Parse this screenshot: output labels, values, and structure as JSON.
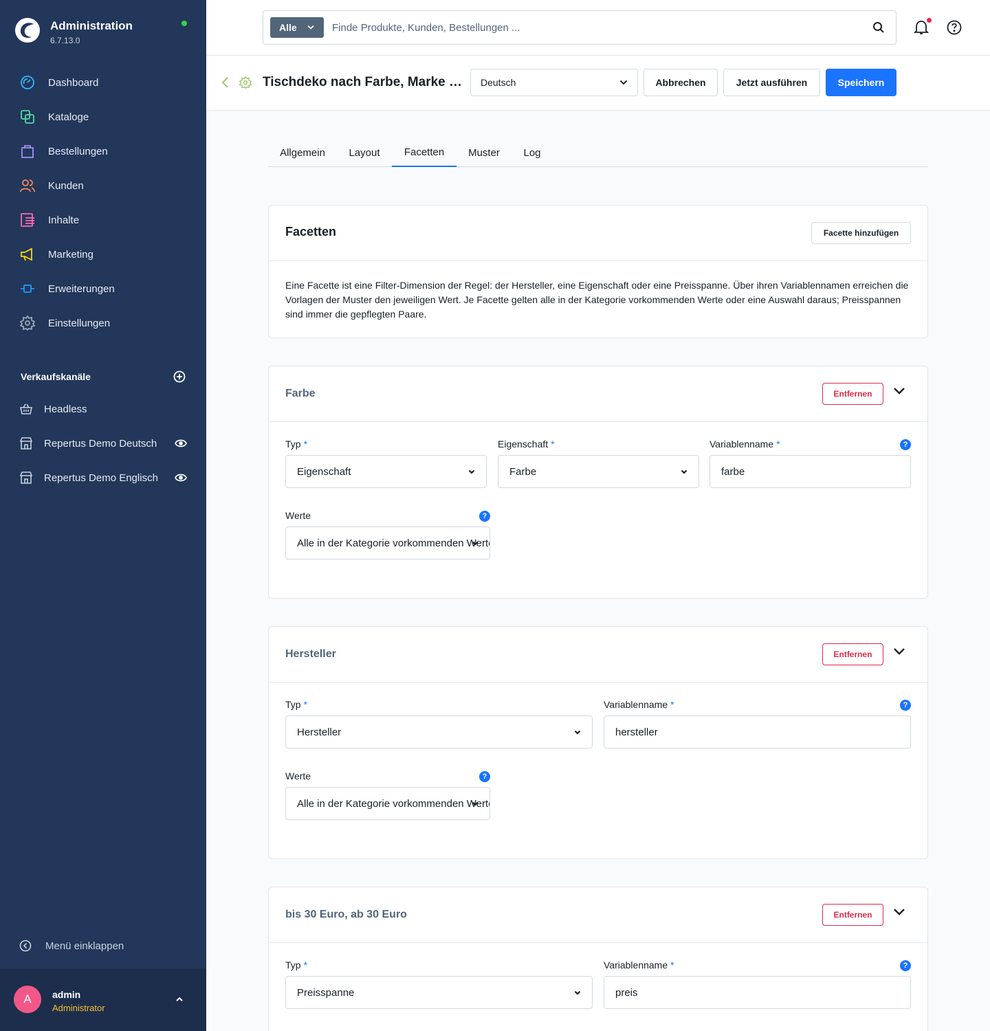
{
  "brand": {
    "title": "Administration",
    "version": "6.7.13.0"
  },
  "nav": [
    {
      "label": "Dashboard",
      "icon": "gauge-icon",
      "color": "#33b8ff"
    },
    {
      "label": "Kataloge",
      "icon": "catalog-icon",
      "color": "#57d9a3"
    },
    {
      "label": "Bestellungen",
      "icon": "shopping-bag-icon",
      "color": "#a092f0"
    },
    {
      "label": "Kunden",
      "icon": "users-icon",
      "color": "#f88962"
    },
    {
      "label": "Inhalte",
      "icon": "content-icon",
      "color": "#ff68b4"
    },
    {
      "label": "Marketing",
      "icon": "megaphone-icon",
      "color": "#ffd700"
    },
    {
      "label": "Erweiterungen",
      "icon": "plug-icon",
      "color": "#189eff"
    },
    {
      "label": "Einstellungen",
      "icon": "gear-icon",
      "color": "#9aa8b5"
    }
  ],
  "sales_channels": {
    "heading": "Verkaufskanäle",
    "items": [
      {
        "label": "Headless",
        "icon": "basket-icon"
      },
      {
        "label": "Repertus Demo Deutsch",
        "icon": "storefront-icon"
      },
      {
        "label": "Repertus Demo Englisch",
        "icon": "storefront-icon"
      }
    ]
  },
  "collapse_label": "Menü einklappen",
  "user": {
    "initial": "A",
    "name": "admin",
    "role": "Administrator"
  },
  "search": {
    "type": "Alle",
    "placeholder": "Finde Produkte, Kunden, Bestellungen ..."
  },
  "smartbar": {
    "title": "Tischdeko nach Farbe, Marke und Preis",
    "language": "Deutsch",
    "cancel": "Abbrechen",
    "run": "Jetzt ausführen",
    "save": "Speichern"
  },
  "tabs": [
    "Allgemein",
    "Layout",
    "Facetten",
    "Muster",
    "Log"
  ],
  "facets_card": {
    "title": "Facetten",
    "add_button": "Facette hinzufügen",
    "description": "Eine Facette ist eine Filter-Dimension der Regel: der Hersteller, eine Eigenschaft oder eine Preisspanne. Über ihren Variablennamen erreichen die Vorlagen der Muster den jeweiligen Wert. Je Facette gelten alle in der Kategorie vorkommenden Werte oder eine Auswahl daraus; Preisspannen sind immer die gepflegten Paare."
  },
  "labels": {
    "type": "Typ",
    "property": "Eigenschaft",
    "variable": "Variablenname",
    "values": "Werte",
    "remove": "Entfernen",
    "required": "*",
    "help": "?"
  },
  "facets": [
    {
      "title": "Farbe",
      "type": "Eigenschaft",
      "property": "Farbe",
      "variable": "farbe",
      "values": "Alle in der Kategorie vorkommenden Werte"
    },
    {
      "title": "Hersteller",
      "type": "Hersteller",
      "variable": "hersteller",
      "values": "Alle in der Kategorie vorkommenden Werte"
    },
    {
      "title": "bis 30 Euro, ab 30 Euro",
      "type": "Preisspanne",
      "variable": "preis"
    }
  ],
  "colors": {
    "primary": "#1a74ff",
    "danger": "#de294c",
    "sidebar": "#22375a",
    "online": "#37d046"
  }
}
